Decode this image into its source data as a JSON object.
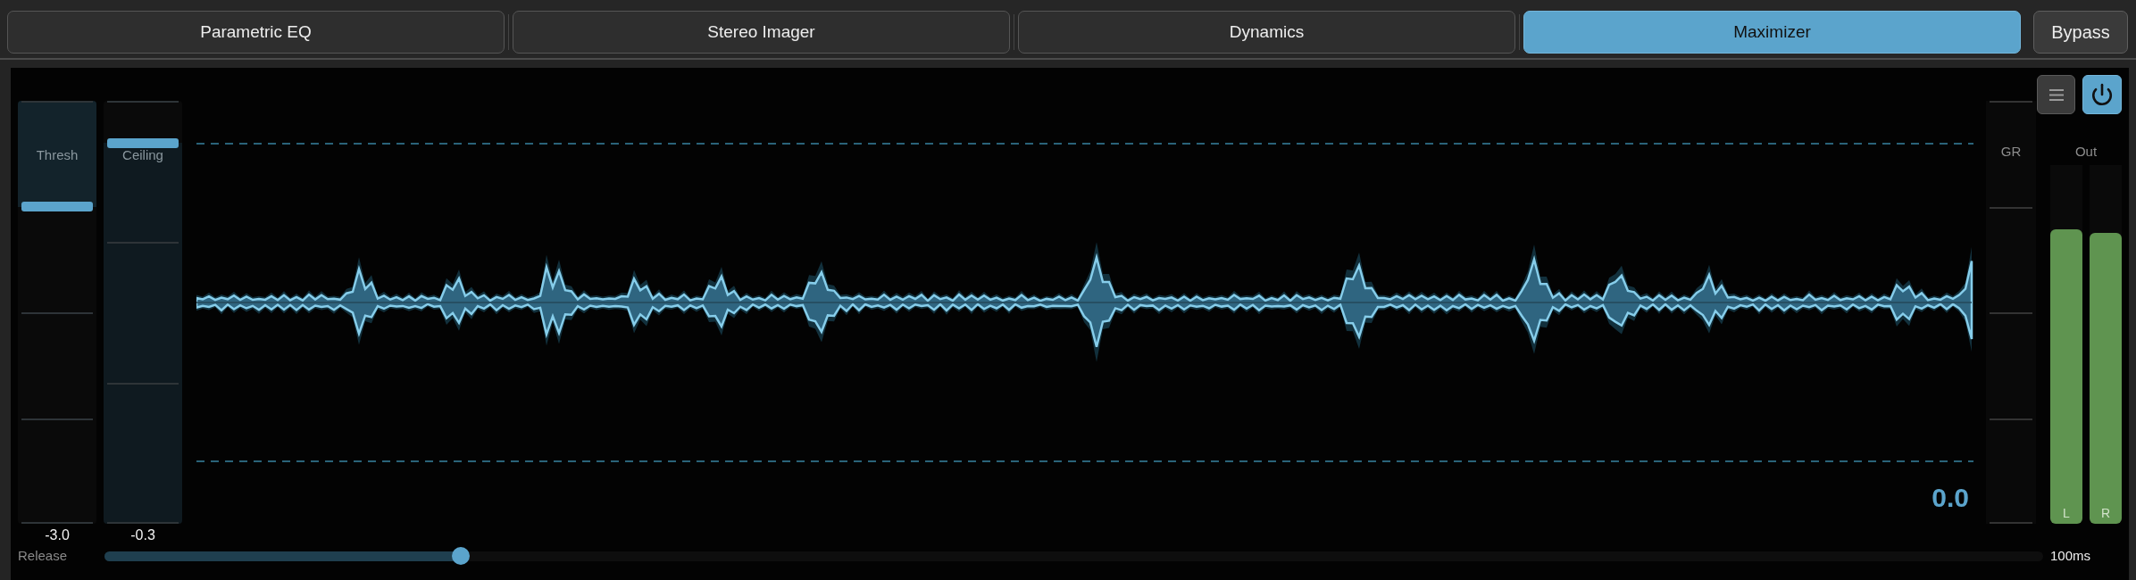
{
  "tabs": [
    {
      "label": "Parametric EQ",
      "selected": false
    },
    {
      "label": "Stereo Imager",
      "selected": false
    },
    {
      "label": "Dynamics",
      "selected": false
    },
    {
      "label": "Maximizer",
      "selected": true
    }
  ],
  "bypass": {
    "label": "Bypass",
    "on": false
  },
  "power": {
    "on": true
  },
  "faders": [
    {
      "kind": "threshold",
      "label": "Thresh",
      "value": "-3.0",
      "level": 0.75
    },
    {
      "kind": "ceiling",
      "label": "Ceiling",
      "value": "-0.3",
      "level": 0.9
    }
  ],
  "display": {
    "readout": "0.0"
  },
  "gr_meter": {
    "label": "GR"
  },
  "out_meter": {
    "label": "Out",
    "channels": [
      {
        "label": "L",
        "level": 0.82
      },
      {
        "label": "R",
        "level": 0.81
      }
    ]
  },
  "release": {
    "label": "Release",
    "level": 0.184,
    "value": "100ms"
  }
}
